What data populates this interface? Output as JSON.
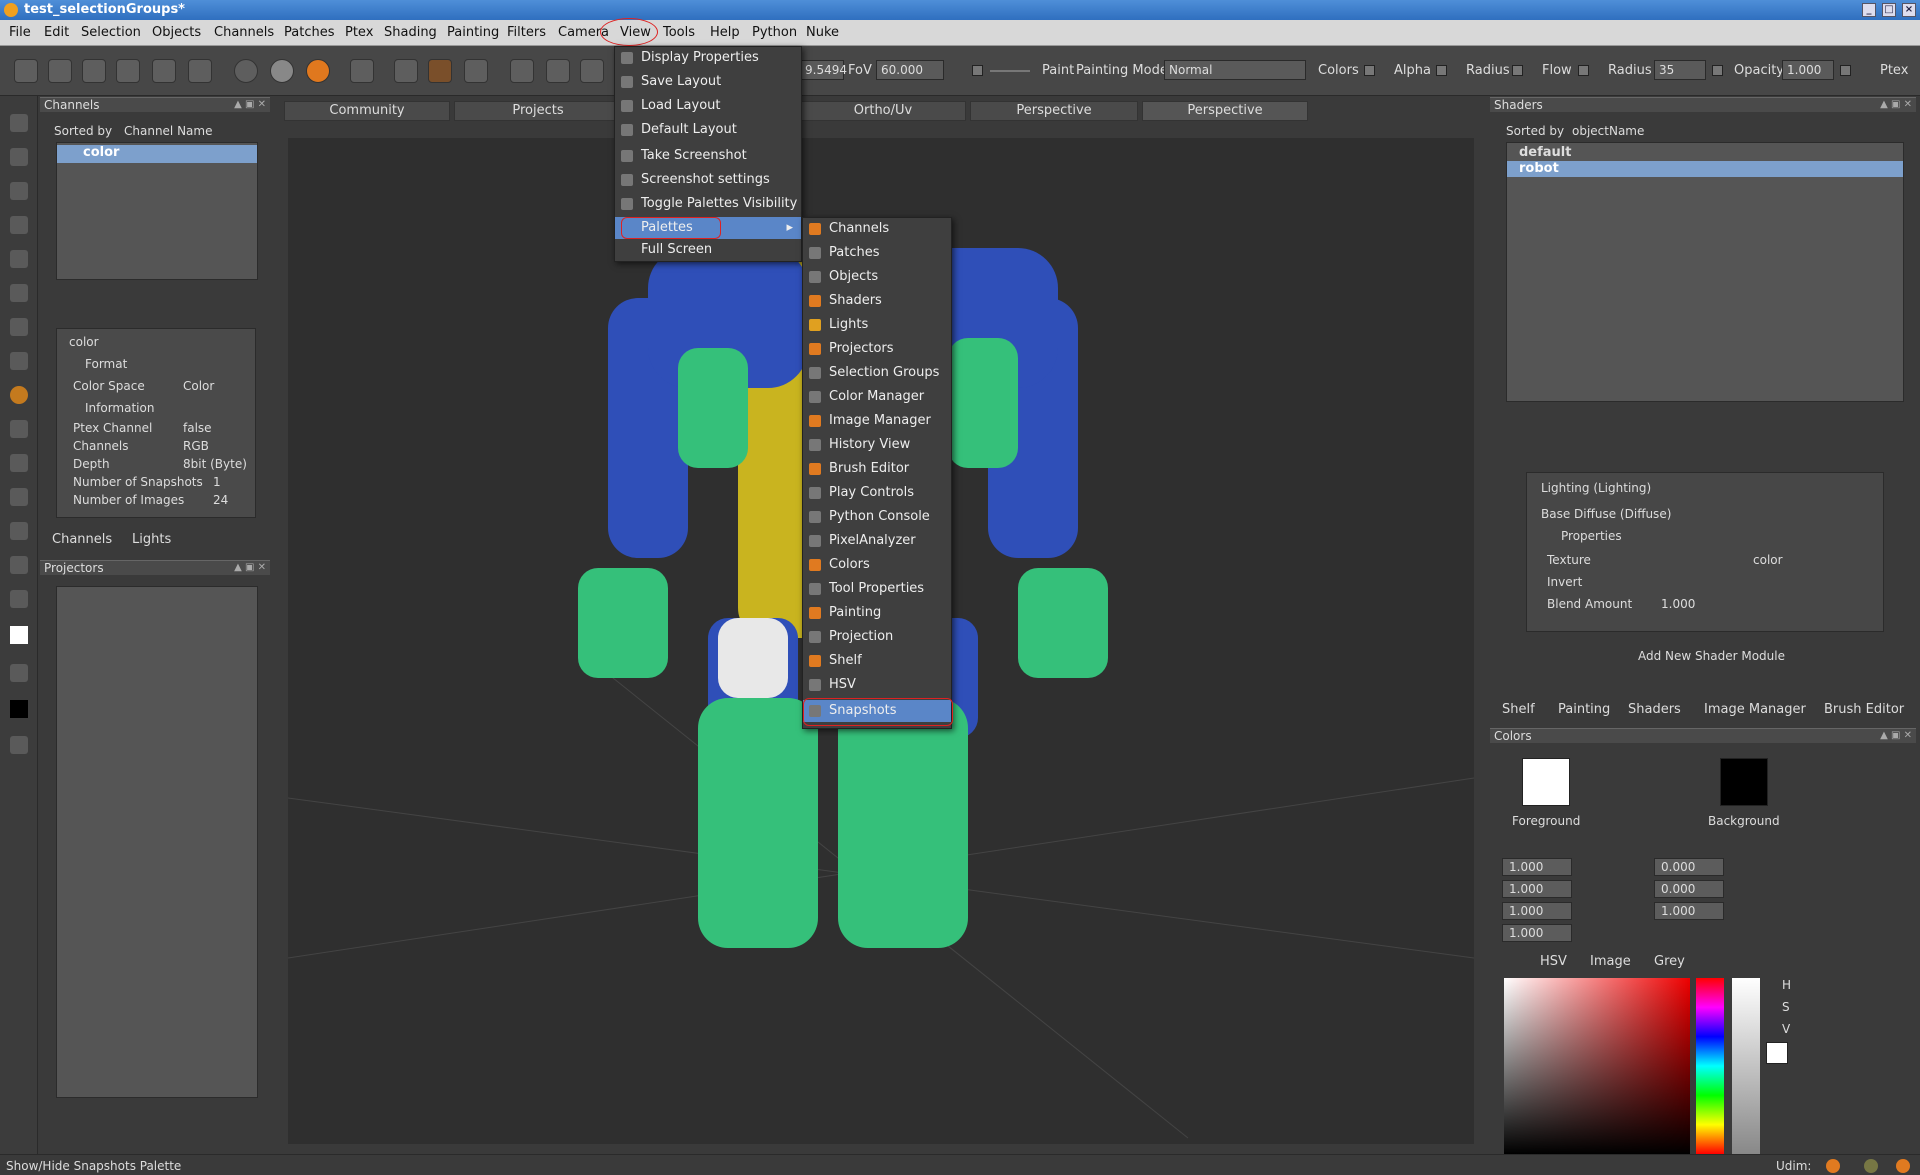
{
  "window": {
    "title": "test_selectionGroups*"
  },
  "menubar": [
    "File",
    "Edit",
    "Selection",
    "Objects",
    "Channels",
    "Patches",
    "Ptex",
    "Shading",
    "Painting",
    "Filters",
    "Camera",
    "View",
    "Tools",
    "Help",
    "Python",
    "Nuke"
  ],
  "toolbar": {
    "fov_value_left": "9.5494",
    "fov_label": "FoV",
    "fov_value": "60.000",
    "paint_label": "Paint",
    "painting_mode_label": "Painting Mode",
    "painting_mode_value": "Normal",
    "colors_label": "Colors",
    "alpha_label": "Alpha",
    "radius_label": "Radius",
    "flow_label": "Flow",
    "radius2_label": "Radius",
    "radius2_value": "35",
    "opacity_label": "Opacity",
    "opacity_value": "1.000",
    "ptex_label": "Ptex"
  },
  "channels_panel": {
    "title": "Channels",
    "sorted_by_label": "Sorted by",
    "sorted_by_value": "Channel Name",
    "items": [
      "color"
    ],
    "props_header": "color",
    "format_section": "Format",
    "color_space_label": "Color Space",
    "color_space_value": "Color",
    "information_section": "Information",
    "info_rows": [
      {
        "k": "Ptex Channel",
        "v": "false"
      },
      {
        "k": "Channels",
        "v": "RGB"
      },
      {
        "k": "Depth",
        "v": "8bit  (Byte)"
      },
      {
        "k": "Number of Snapshots",
        "v": "1"
      },
      {
        "k": "Number of Images",
        "v": "24"
      }
    ],
    "tabs": [
      "Channels",
      "Lights"
    ]
  },
  "projectors_panel": {
    "title": "Projectors"
  },
  "view_tabs": [
    "Community",
    "Projects",
    "",
    "Ortho/Uv",
    "Perspective",
    "Perspective"
  ],
  "view_menu": {
    "items": [
      "Display Properties",
      "Save Layout",
      "Load Layout",
      "Default Layout",
      "Take Screenshot",
      "Screenshot settings",
      "Toggle Palettes Visibility",
      "Palettes",
      "Full Screen"
    ]
  },
  "palettes_submenu": {
    "items": [
      "Channels",
      "Patches",
      "Objects",
      "Shaders",
      "Lights",
      "Projectors",
      "Selection Groups",
      "Color Manager",
      "Image Manager",
      "History View",
      "Brush Editor",
      "Play Controls",
      "Python Console",
      "PixelAnalyzer",
      "Colors",
      "Tool Properties",
      "Painting",
      "Projection",
      "Shelf",
      "HSV",
      "Snapshots"
    ]
  },
  "shaders_panel": {
    "title": "Shaders",
    "sorted_by_label": "Sorted by",
    "sorted_by_value": "objectName",
    "items": [
      "default",
      "robot"
    ],
    "modules": [
      "Lighting (Lighting)",
      "Base Diffuse (Diffuse)"
    ],
    "properties_section": "Properties",
    "texture_label": "Texture",
    "texture_value": "color",
    "invert_label": "Invert",
    "blend_label": "Blend Amount",
    "blend_value": "1.000",
    "add_module": "Add New Shader Module",
    "tabs": [
      "Shelf",
      "Painting",
      "Shaders",
      "Image Manager",
      "Brush Editor"
    ]
  },
  "colors_panel": {
    "title": "Colors",
    "foreground_label": "Foreground",
    "background_label": "Background",
    "fields_left": [
      "1.000",
      "1.000",
      "1.000",
      "1.000"
    ],
    "fields_right": [
      "0.000",
      "0.000",
      "1.000"
    ],
    "tabs": [
      "HSV",
      "Image",
      "Grey"
    ],
    "hsv_labels": [
      "H",
      "S",
      "V"
    ]
  },
  "statusbar": {
    "text": "Show/Hide Snapshots Palette",
    "udim_label": "Udim:"
  }
}
